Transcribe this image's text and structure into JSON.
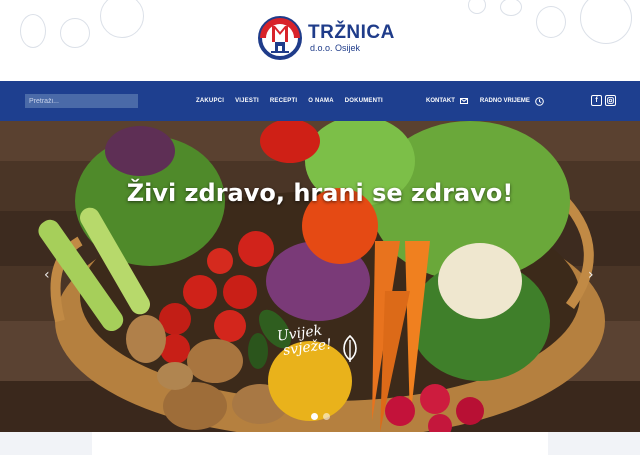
{
  "brand": {
    "name": "TRŽNICA",
    "subtitle": "d.o.o. Osijek"
  },
  "search": {
    "placeholder": "Pretraži..."
  },
  "nav": {
    "links": [
      "ZAKUPCI",
      "VIJESTI",
      "RECEPTI",
      "O NAMA",
      "DOKUMENTI"
    ],
    "contact_label": "KONTAKT",
    "hours_label": "RADNO VRIJEME",
    "contact_icon": "envelope-icon",
    "hours_icon": "clock-icon",
    "social": [
      "facebook-icon",
      "instagram-icon"
    ]
  },
  "hero": {
    "title": "Živi zdravo, hrani se zdravo!",
    "badge_line1": "Uvijek",
    "badge_line2": "svježe!",
    "slide_count": 2,
    "active_slide": 1
  },
  "colors": {
    "navbar": "#1e3f8f",
    "brand_blue": "#1f3c8a",
    "brand_red": "#d8232a"
  }
}
